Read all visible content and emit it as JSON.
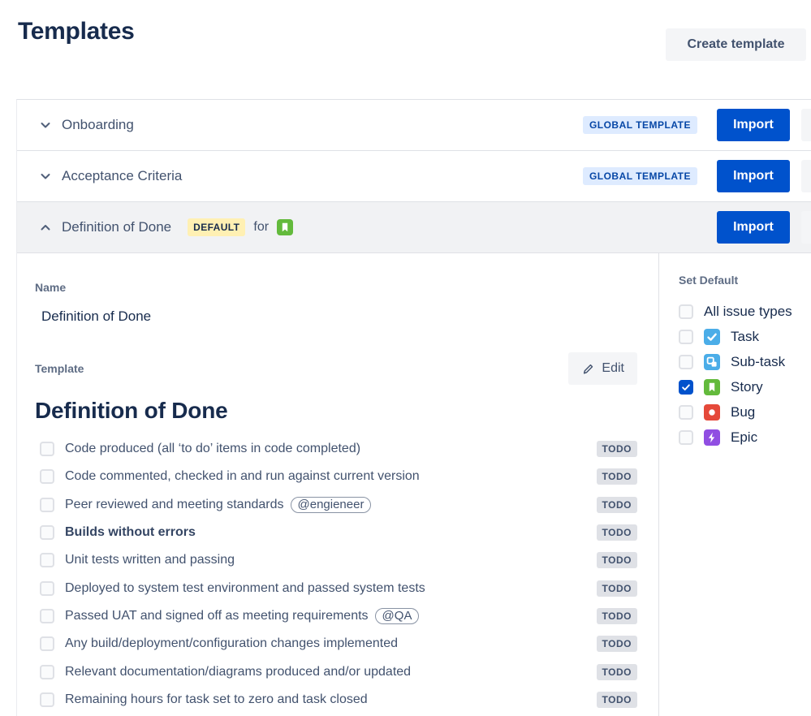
{
  "page": {
    "title": "Templates",
    "create_button": "Create template"
  },
  "colors": {
    "primary_blue": "#0052CC",
    "navy": "#172B4D",
    "global_badge_bg": "#DEEBFF",
    "global_badge_text": "#0747A6",
    "default_badge_bg": "#FFF0B3",
    "todo_badge_bg": "#DFE1E6",
    "task_blue": "#4BADE8",
    "subtask_blue": "#4BADE8",
    "story_green": "#63BA3C",
    "bug_red": "#E5493A",
    "epic_purple": "#904EE2"
  },
  "rows": [
    {
      "name": "Onboarding",
      "badge": "GLOBAL TEMPLATE",
      "import_label": "Import"
    },
    {
      "name": "Acceptance Criteria",
      "badge": "GLOBAL TEMPLATE",
      "import_label": "Import"
    },
    {
      "name": "Definition of Done",
      "default_badge": "DEFAULT",
      "for_text": "for",
      "import_label": "Import"
    }
  ],
  "detail": {
    "name_label": "Name",
    "name_value": "Definition of Done",
    "template_label": "Template",
    "edit_button": "Edit",
    "heading": "Definition of Done",
    "checklist": [
      {
        "text": "Code produced (all ‘to do’ items in code completed)",
        "status": "TODO"
      },
      {
        "text": "Code commented, checked in and run against current version",
        "status": "TODO"
      },
      {
        "text": "Peer reviewed and meeting standards",
        "mention": "@engieneer",
        "status": "TODO"
      },
      {
        "text": "Builds without errors",
        "bold": true,
        "status": "TODO"
      },
      {
        "text": "Unit tests written and passing",
        "status": "TODO"
      },
      {
        "text": "Deployed to system test environment and passed system tests",
        "status": "TODO"
      },
      {
        "text": "Passed UAT and signed off as meeting requirements",
        "mention": "@QA",
        "status": "TODO"
      },
      {
        "text": "Any build/deployment/configuration changes implemented",
        "status": "TODO"
      },
      {
        "text": "Relevant documentation/diagrams produced and/or updated",
        "status": "TODO"
      },
      {
        "text": "Remaining hours for task set to zero and task closed",
        "status": "TODO"
      }
    ]
  },
  "sidebar": {
    "title": "Set Default",
    "options": [
      {
        "label": "All issue types",
        "checked": false,
        "icon": ""
      },
      {
        "label": "Task",
        "checked": false,
        "icon": "task"
      },
      {
        "label": "Sub-task",
        "checked": false,
        "icon": "subtask"
      },
      {
        "label": "Story",
        "checked": true,
        "icon": "story"
      },
      {
        "label": "Bug",
        "checked": false,
        "icon": "bug"
      },
      {
        "label": "Epic",
        "checked": false,
        "icon": "epic"
      }
    ]
  }
}
